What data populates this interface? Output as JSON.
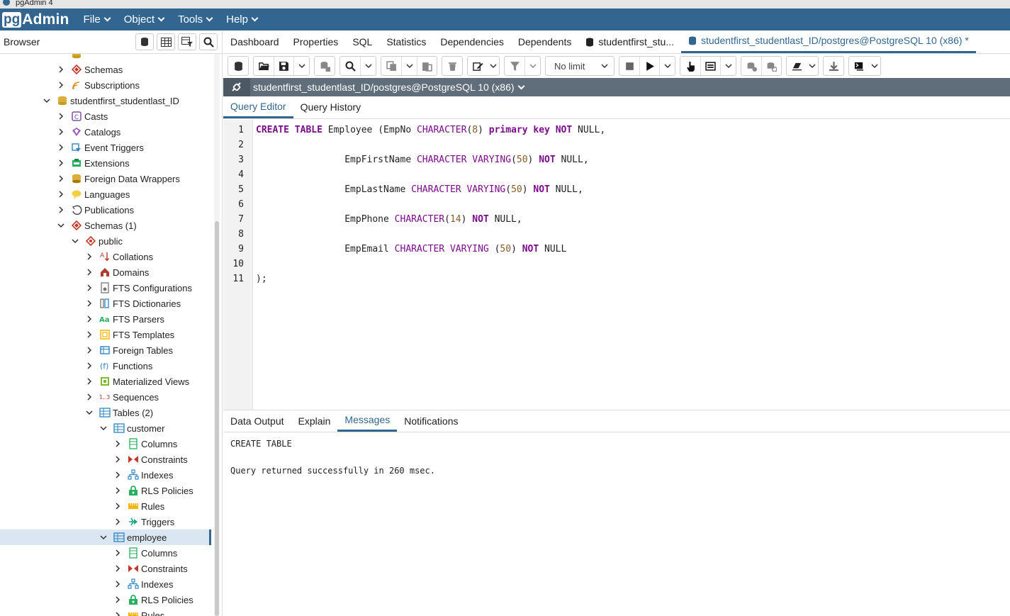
{
  "window": {
    "title": "pgAdmin 4"
  },
  "navbar": {
    "logo_pg": "pg",
    "logo_admin": "Admin",
    "menus": [
      "File",
      "Object",
      "Tools",
      "Help"
    ]
  },
  "browser": {
    "title": "Browser",
    "tree": [
      {
        "label": "",
        "depth": 3,
        "icon": "database-icon",
        "partial": true
      },
      {
        "label": "Schemas",
        "depth": 3,
        "icon": "schemas-icon",
        "expanded": false
      },
      {
        "label": "Subscriptions",
        "depth": 3,
        "icon": "subscriptions-icon",
        "expanded": false
      },
      {
        "label": "studentfirst_studentlast_ID",
        "depth": 2,
        "icon": "database-icon",
        "expanded": true
      },
      {
        "label": "Casts",
        "depth": 3,
        "icon": "casts-icon",
        "expanded": false
      },
      {
        "label": "Catalogs",
        "depth": 3,
        "icon": "catalogs-icon",
        "expanded": false
      },
      {
        "label": "Event Triggers",
        "depth": 3,
        "icon": "event-triggers-icon",
        "expanded": false
      },
      {
        "label": "Extensions",
        "depth": 3,
        "icon": "extensions-icon",
        "expanded": false
      },
      {
        "label": "Foreign Data Wrappers",
        "depth": 3,
        "icon": "foreign-data-wrappers-icon",
        "expanded": false
      },
      {
        "label": "Languages",
        "depth": 3,
        "icon": "languages-icon",
        "expanded": false
      },
      {
        "label": "Publications",
        "depth": 3,
        "icon": "publications-icon",
        "expanded": false
      },
      {
        "label": "Schemas (1)",
        "depth": 3,
        "icon": "schemas-icon",
        "expanded": true
      },
      {
        "label": "public",
        "depth": 4,
        "icon": "schema-icon",
        "expanded": true
      },
      {
        "label": "Collations",
        "depth": 5,
        "icon": "collations-icon",
        "expanded": false
      },
      {
        "label": "Domains",
        "depth": 5,
        "icon": "domains-icon",
        "expanded": false
      },
      {
        "label": "FTS Configurations",
        "depth": 5,
        "icon": "fts-configurations-icon",
        "expanded": false
      },
      {
        "label": "FTS Dictionaries",
        "depth": 5,
        "icon": "fts-dictionaries-icon",
        "expanded": false
      },
      {
        "label": "FTS Parsers",
        "depth": 5,
        "icon": "fts-parsers-icon",
        "expanded": false
      },
      {
        "label": "FTS Templates",
        "depth": 5,
        "icon": "fts-templates-icon",
        "expanded": false
      },
      {
        "label": "Foreign Tables",
        "depth": 5,
        "icon": "foreign-tables-icon",
        "expanded": false
      },
      {
        "label": "Functions",
        "depth": 5,
        "icon": "functions-icon",
        "expanded": false
      },
      {
        "label": "Materialized Views",
        "depth": 5,
        "icon": "materialized-views-icon",
        "expanded": false
      },
      {
        "label": "Sequences",
        "depth": 5,
        "icon": "sequences-icon",
        "expanded": false
      },
      {
        "label": "Tables (2)",
        "depth": 5,
        "icon": "tables-icon",
        "expanded": true
      },
      {
        "label": "customer",
        "depth": 6,
        "icon": "table-icon",
        "expanded": true
      },
      {
        "label": "Columns",
        "depth": 7,
        "icon": "columns-icon",
        "expanded": false
      },
      {
        "label": "Constraints",
        "depth": 7,
        "icon": "constraints-icon",
        "expanded": false
      },
      {
        "label": "Indexes",
        "depth": 7,
        "icon": "indexes-icon",
        "expanded": false
      },
      {
        "label": "RLS Policies",
        "depth": 7,
        "icon": "rls-policies-icon",
        "expanded": false
      },
      {
        "label": "Rules",
        "depth": 7,
        "icon": "rules-icon",
        "expanded": false
      },
      {
        "label": "Triggers",
        "depth": 7,
        "icon": "triggers-icon",
        "expanded": false
      },
      {
        "label": "employee",
        "depth": 6,
        "icon": "table-icon",
        "expanded": true,
        "selected": true
      },
      {
        "label": "Columns",
        "depth": 7,
        "icon": "columns-icon",
        "expanded": false
      },
      {
        "label": "Constraints",
        "depth": 7,
        "icon": "constraints-icon",
        "expanded": false
      },
      {
        "label": "Indexes",
        "depth": 7,
        "icon": "indexes-icon",
        "expanded": false
      },
      {
        "label": "RLS Policies",
        "depth": 7,
        "icon": "rls-policies-icon",
        "expanded": false
      },
      {
        "label": "Rules",
        "depth": 7,
        "icon": "rules-icon",
        "expanded": false
      }
    ]
  },
  "main_tabs": [
    {
      "label": "Dashboard"
    },
    {
      "label": "Properties"
    },
    {
      "label": "SQL"
    },
    {
      "label": "Statistics"
    },
    {
      "label": "Dependencies"
    },
    {
      "label": "Dependents"
    },
    {
      "label": "studentfirst_stu...",
      "icon": "database-icon"
    },
    {
      "label": "studentfirst_studentlast_ID/postgres@PostgreSQL 10 (x86) *",
      "icon": "query-tool-icon",
      "active": true
    }
  ],
  "toolbar": {
    "limit": "No limit"
  },
  "connection": {
    "label": "studentfirst_studentlast_ID/postgres@PostgreSQL 10 (x86)"
  },
  "editor_tabs": [
    {
      "label": "Query Editor",
      "active": true
    },
    {
      "label": "Query History"
    }
  ],
  "editor": {
    "line_numbers": [
      "1",
      "2",
      "3",
      "4",
      "5",
      "6",
      "7",
      "8",
      "9",
      "10",
      "11"
    ],
    "lines": [
      "CREATE TABLE Employee (EmpNo CHARACTER(8) primary key NOT NULL,",
      "",
      "                EmpFirstName CHARACTER VARYING(50) NOT NULL,",
      "",
      "                EmpLastName CHARACTER VARYING(50) NOT NULL,",
      "",
      "                EmpPhone CHARACTER(14) NOT NULL,",
      "",
      "                EmpEmail CHARACTER VARYING (50) NOT NULL",
      "",
      ");"
    ]
  },
  "result_tabs": [
    {
      "label": "Data Output"
    },
    {
      "label": "Explain"
    },
    {
      "label": "Messages",
      "active": true
    },
    {
      "label": "Notifications"
    }
  ],
  "messages": {
    "line1": "CREATE TABLE",
    "line2": "Query returned successfully in 260 msec."
  }
}
